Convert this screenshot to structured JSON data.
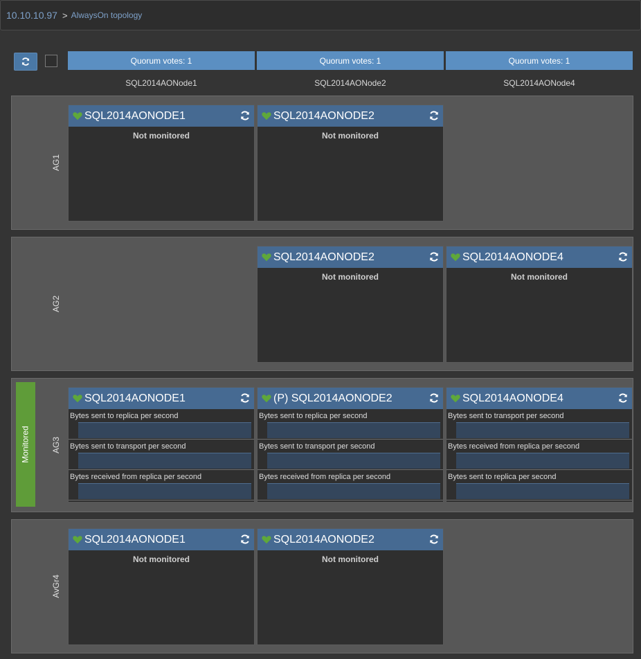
{
  "breadcrumb": {
    "host": "10.10.10.97",
    "separator": ">",
    "page": "AlwaysOn topology"
  },
  "nodes": [
    {
      "quorum": "Quorum votes: 1",
      "name": "SQL2014AONode1"
    },
    {
      "quorum": "Quorum votes: 1",
      "name": "SQL2014AONode2"
    },
    {
      "quorum": "Quorum votes: 1",
      "name": "SQL2014AONode4"
    }
  ],
  "groups": [
    {
      "label": "AG1",
      "replicas": [
        {
          "title": "SQL2014AONODE1",
          "status": "Not monitored"
        },
        {
          "title": "SQL2014AONODE2",
          "status": "Not monitored"
        }
      ]
    },
    {
      "label": "AG2",
      "replicas": [
        {
          "title": "SQL2014AONODE2",
          "status": "Not monitored"
        },
        {
          "title": "SQL2014AONODE4",
          "status": "Not monitored"
        }
      ]
    },
    {
      "label": "AG3",
      "badge": "Monitored",
      "replicas": [
        {
          "title": "SQL2014AONODE1",
          "metrics": [
            "Bytes sent to replica per second",
            "Bytes sent to transport per second",
            "Bytes received from replica per second"
          ]
        },
        {
          "title": "(P) SQL2014AONODE2",
          "metrics": [
            "Bytes sent to replica per second",
            "Bytes sent to transport per second",
            "Bytes received from replica per second"
          ]
        },
        {
          "title": "SQL2014AONODE4",
          "metrics": [
            "Bytes sent to transport per second",
            "Bytes received from replica per second",
            "Bytes sent to replica per second"
          ]
        }
      ]
    },
    {
      "label": "AvGr4",
      "replicas": [
        {
          "title": "SQL2014AONODE1",
          "status": "Not monitored"
        },
        {
          "title": "SQL2014AONODE2",
          "status": "Not monitored"
        }
      ]
    }
  ],
  "colors": {
    "healthy": "#5fa83a",
    "header": "#466a92",
    "monitored": "#5f9c39",
    "quorum": "#5b8fc2"
  },
  "icons": {
    "health": "heart-icon",
    "refresh": "refresh-icon"
  }
}
